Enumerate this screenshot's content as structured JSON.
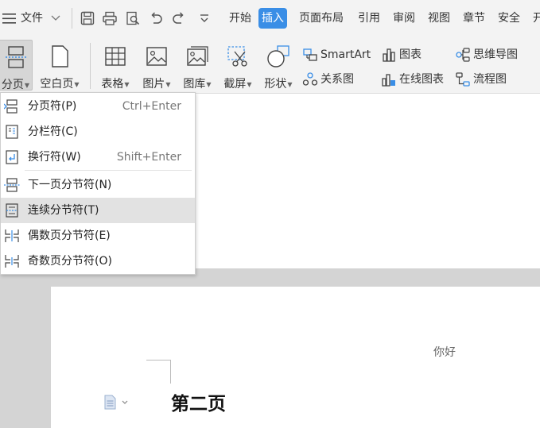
{
  "menubar": {
    "file_label": "文件",
    "tabs": [
      {
        "label": "开始"
      },
      {
        "label": "插入"
      },
      {
        "label": "页面布局"
      },
      {
        "label": "引用"
      },
      {
        "label": "审阅"
      },
      {
        "label": "视图"
      },
      {
        "label": "章节"
      },
      {
        "label": "安全"
      },
      {
        "label": "开"
      }
    ],
    "active_tab": "插入",
    "accent_color": "#3a8ee6"
  },
  "ribbon": {
    "large_buttons": [
      {
        "label": "分页",
        "icon": "page-break-icon",
        "has_dropdown": true,
        "pressed": true
      },
      {
        "label": "空白页",
        "icon": "blank-page-icon",
        "has_dropdown": true
      },
      {
        "label": "表格",
        "icon": "table-icon",
        "has_dropdown": true
      },
      {
        "label": "图片",
        "icon": "picture-icon",
        "has_dropdown": true
      },
      {
        "label": "图库",
        "icon": "gallery-icon",
        "has_dropdown": true
      },
      {
        "label": "截屏",
        "icon": "screenshot-icon",
        "has_dropdown": true
      },
      {
        "label": "形状",
        "icon": "shapes-icon",
        "has_dropdown": true
      }
    ],
    "small_buttons": [
      {
        "label": "SmartArt",
        "icon": "smartart-icon"
      },
      {
        "label": "图表",
        "icon": "chart-icon"
      },
      {
        "label": "思维导图",
        "icon": "mind-map-icon"
      },
      {
        "label": "关系图",
        "icon": "relation-chart-icon"
      },
      {
        "label": "在线图表",
        "icon": "online-chart-icon"
      },
      {
        "label": "流程图",
        "icon": "flowchart-icon"
      }
    ]
  },
  "dropdown": {
    "items": [
      {
        "label": "分页符(P)",
        "shortcut": "Ctrl+Enter",
        "icon": "page-break-icon"
      },
      {
        "label": "分栏符(C)",
        "shortcut": "",
        "icon": "column-break-icon"
      },
      {
        "label": "换行符(W)",
        "shortcut": "Shift+Enter",
        "icon": "line-break-icon"
      },
      {
        "label": "下一页分节符(N)",
        "shortcut": "",
        "icon": "next-page-section-icon"
      },
      {
        "label": "连续分节符(T)",
        "shortcut": "",
        "icon": "continuous-section-icon",
        "highlighted": true
      },
      {
        "label": "偶数页分节符(E)",
        "shortcut": "",
        "icon": "even-page-section-icon"
      },
      {
        "label": "奇数页分节符(O)",
        "shortcut": "",
        "icon": "odd-page-section-icon"
      }
    ]
  },
  "document": {
    "header_text": "你好",
    "heading_text": "第二页"
  }
}
